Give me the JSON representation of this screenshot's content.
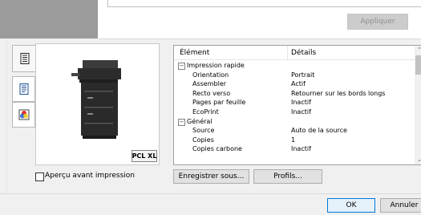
{
  "toolbar": {
    "apply_label": "Appliquer"
  },
  "preview": {
    "pcl_badge": "PCL XL",
    "checkbox_label": "Aperçu avant impression",
    "checked": false
  },
  "table": {
    "headers": {
      "element": "Élément",
      "details": "Détails"
    },
    "rows": [
      {
        "name": "Impression rapide",
        "value": "",
        "group": true
      },
      {
        "name": "Orientation",
        "value": "Portrait"
      },
      {
        "name": "Assembler",
        "value": "Actif"
      },
      {
        "name": "Recto verso",
        "value": "Retourner sur les bords longs"
      },
      {
        "name": "Pages par feuille",
        "value": "Inactif"
      },
      {
        "name": "EcoPrint",
        "value": "Inactif"
      },
      {
        "name": "Général",
        "value": "",
        "group": true
      },
      {
        "name": "Source",
        "value": "Auto de la source"
      },
      {
        "name": "Copies",
        "value": "1"
      },
      {
        "name": "Copies carbone",
        "value": "Inactif"
      }
    ],
    "expander_symbol": "−"
  },
  "buttons": {
    "save_as": "Enregistrer sous...",
    "profiles": "Profils...",
    "ok": "OK",
    "cancel": "Annuler"
  },
  "icons": {
    "status": "printer-status-icon",
    "document": "document-icon",
    "color": "color-icon"
  }
}
